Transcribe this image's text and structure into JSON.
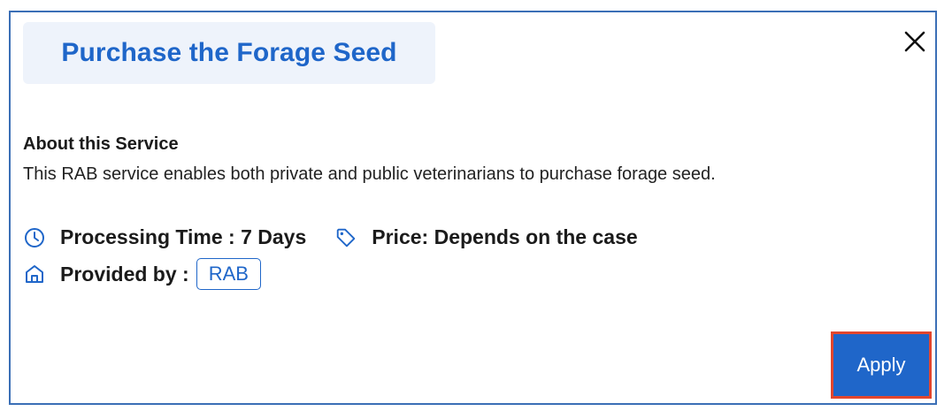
{
  "modal": {
    "title": "Purchase the Forage Seed",
    "close_icon": "close-icon"
  },
  "about": {
    "heading": "About this Service",
    "description": "This RAB service enables both private and public veterinarians to purchase forage seed."
  },
  "details": {
    "processing_time": "Processing Time : 7 Days",
    "price": "Price: Depends on the case",
    "provided_by_label": "Provided by :",
    "provider": "RAB"
  },
  "actions": {
    "apply_label": "Apply"
  },
  "colors": {
    "accent": "#1f66c9",
    "title_bg": "#eef3fb",
    "modal_border": "#3b6fb6",
    "highlight": "#e2462e"
  }
}
